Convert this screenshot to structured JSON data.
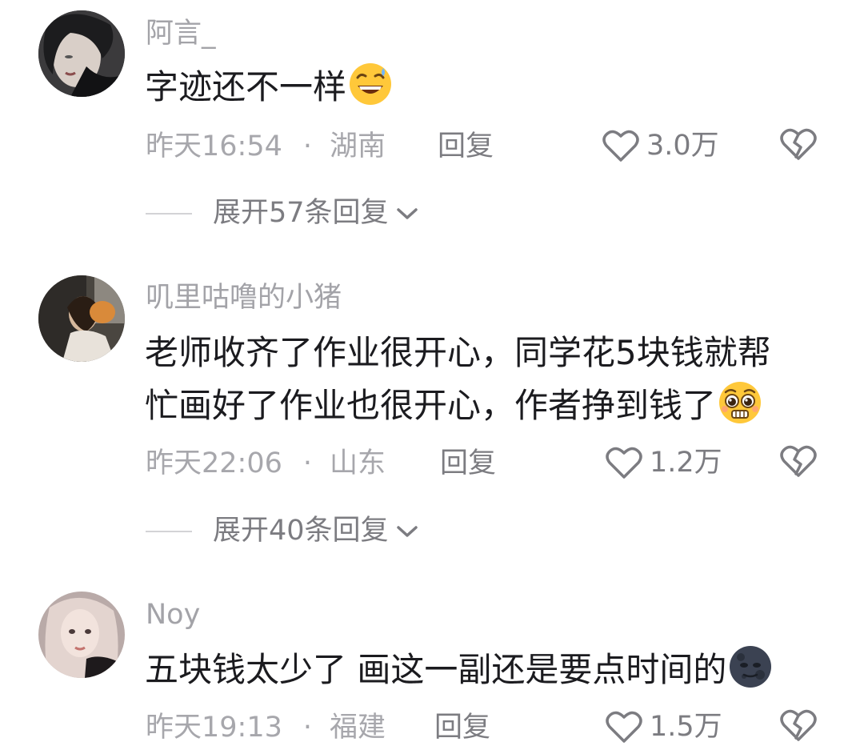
{
  "comments": [
    {
      "username": "阿言_",
      "text_lines": [
        "字迹还不一样"
      ],
      "emoji": "grinning-sweat-emoji",
      "time": "昨天16:54",
      "separator": "·",
      "location": "湖南",
      "reply_label": "回复",
      "likes": "3.0万",
      "expand_label": "展开57条回复"
    },
    {
      "username": "叽里咕噜的小猪",
      "text_lines": [
        "老师收齐了作业很开心，同学花5块钱就帮",
        "忙画好了作业也很开心，作者挣到钱了"
      ],
      "emoji": "pleading-face-emoji",
      "time": "昨天22:06",
      "separator": "·",
      "location": "山东",
      "reply_label": "回复",
      "likes": "1.2万",
      "expand_label": "展开40条回复"
    },
    {
      "username": "Noy",
      "text_lines": [
        "五块钱太少了 画这一副还是要点时间的"
      ],
      "emoji": "new-moon-face-emoji",
      "time": "昨天19:13",
      "separator": "·",
      "location": "福建",
      "reply_label": "回复",
      "likes": "1.5万"
    }
  ],
  "icons": {
    "like": "heart-outline-icon",
    "dislike": "broken-heart-icon",
    "expand": "chevron-down-icon"
  },
  "colors": {
    "username": "#a3a3a8",
    "content": "#1b1b1f",
    "meta": "#a7a7ac",
    "action": "#7c7c81"
  }
}
